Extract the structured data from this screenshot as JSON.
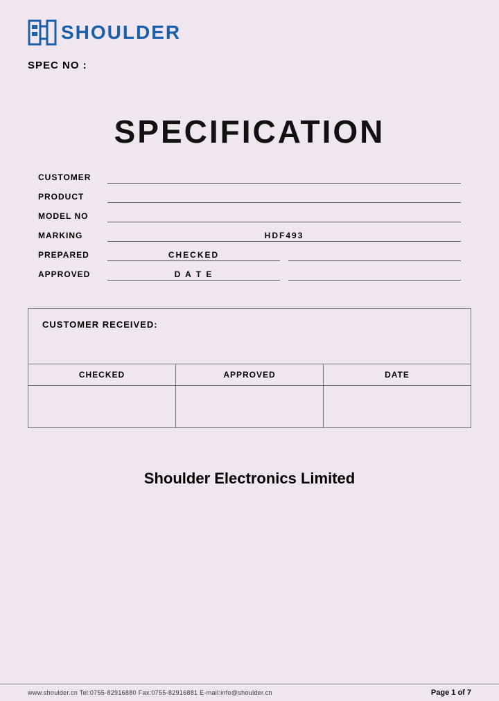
{
  "header": {
    "logo_text": "SHOULDER",
    "spec_no_label": "SPEC NO :"
  },
  "main": {
    "title": "SPECIFICATION"
  },
  "info": {
    "customer_label": "CUSTOMER",
    "product_label": "PRODUCT",
    "model_no_label": "MODEL NO",
    "marking_label": "MARKING",
    "marking_value": "HDF493",
    "prepared_label": "PREPARED",
    "prepared_value": "CHECKED",
    "approved_label": "APPROVED",
    "approved_value": "D A T E"
  },
  "box": {
    "customer_received_label": "CUSTOMER RECEIVED:",
    "col_checked": "CHECKED",
    "col_approved": "APPROVED",
    "col_date": "DATE"
  },
  "footer": {
    "company_name": "Shoulder Electronics Limited",
    "contact": "www.shoulder.cn   Tel:0755-82916880   Fax:0755-82916881   E-mail:info@shoulder.cn",
    "page": "Page 1 of 7"
  }
}
